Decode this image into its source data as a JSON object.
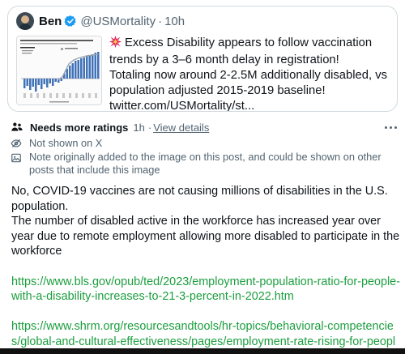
{
  "quoted_post": {
    "author_name": "Ben",
    "handle": "@USMortality",
    "separator": "·",
    "time": "10h",
    "lines": [
      "Excess Disability appears to follow vaccination trends by a 3–6 month delay in registration!",
      "Totaling now around 2-2.5M additionally disabled, vs population adjusted 2015-2019 baseline!",
      "twitter.com/USMortality/st..."
    ],
    "thumbnail_icon": "excess-disability-chart-thumbnail"
  },
  "note": {
    "title": "Needs more ratings",
    "time": "1h",
    "separator": "·",
    "view_details": "View details",
    "not_shown": "Not shown on X",
    "added_text": "Note originally added to the image on this post, and could be shown on other posts that include this image",
    "body_paragraphs": [
      "No, COVID-19 vaccines are not causing millions of disabilities in the U.S. population.",
      "The number of disabled active in the workforce has increased year over year due to remote employment allowing more disabled to participate in the workforce"
    ],
    "links": [
      "https://www.bls.gov/opub/ted/2023/employment-population-ratio-for-people-with-a-disability-increases-to-21-3-percent-in-2022.htm",
      "https://www.shrm.org/resourcesandtools/hr-topics/behavioral-competencies/global-and-cultural-effectiveness/pages/employment-rate-rising-for-people-with-disabilities.aspx"
    ]
  },
  "colors": {
    "link_green": "#1b9e3e",
    "muted": "#536471",
    "verified_blue": "#1d9bf0",
    "burst_red": "#e0245e"
  }
}
